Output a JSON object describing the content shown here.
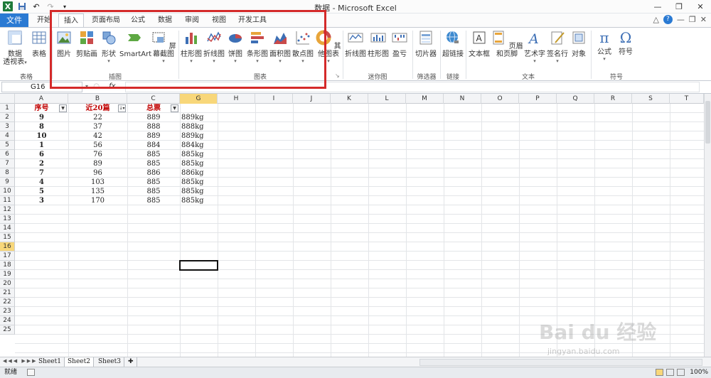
{
  "window": {
    "title": "数据 - Microsoft Excel",
    "controls": [
      "minimize-icon",
      "restore-icon",
      "close-icon"
    ]
  },
  "tabs": {
    "file": "文件",
    "items": [
      {
        "label": "开始"
      },
      {
        "label": "插入",
        "active": true
      },
      {
        "label": "页面布局"
      },
      {
        "label": "公式"
      },
      {
        "label": "数据"
      },
      {
        "label": "审阅"
      },
      {
        "label": "视图"
      },
      {
        "label": "开发工具"
      }
    ]
  },
  "ribbon": {
    "groups": {
      "table": "表格",
      "illustration": "插图",
      "chart": "图表",
      "sparkline": "迷你图",
      "filter": "筛选器",
      "link": "链接",
      "text": "文本",
      "symbol": "符号"
    },
    "buttons": {
      "pivot_line1": "数据",
      "pivot_line2": "透视表",
      "table": "表格",
      "picture": "图片",
      "clipart": "剪贴画",
      "shapes": "形状",
      "smartart": "SmartArt",
      "screenshot": "屏幕截图",
      "column_chart": "柱形图",
      "line_chart": "折线图",
      "pie_chart": "饼图",
      "bar_chart": "条形图",
      "area_chart": "面积图",
      "scatter_chart": "散点图",
      "other_chart": "其他图表",
      "spark_line": "折线图",
      "spark_column": "柱形图",
      "spark_winloss": "盈亏",
      "slicer": "切片器",
      "hyperlink": "超链接",
      "textbox": "文本框",
      "header_footer": "页眉和页脚",
      "wordart": "艺术字",
      "signature": "签名行",
      "object": "对象",
      "equation": "公式",
      "symbol": "符号"
    }
  },
  "formula_bar": {
    "name_box": "G16",
    "fx": "fx",
    "value": ""
  },
  "sheet": {
    "columns": [
      "A",
      "B",
      "C",
      "G",
      "H",
      "I",
      "J",
      "K",
      "L",
      "M",
      "N",
      "O",
      "P",
      "Q",
      "R",
      "S",
      "T"
    ],
    "rows": [
      "1",
      "2",
      "3",
      "4",
      "5",
      "6",
      "7",
      "8",
      "9",
      "10",
      "11",
      "12",
      "13",
      "14",
      "15",
      "16",
      "17",
      "18",
      "19",
      "20",
      "21",
      "22",
      "23",
      "24",
      "25"
    ],
    "headers": {
      "a": "序号",
      "b": "近20篇",
      "c": "总票"
    },
    "data": [
      {
        "a": "9",
        "b": "22",
        "c": "889",
        "g": "889kg"
      },
      {
        "a": "8",
        "b": "37",
        "c": "888",
        "g": "888kg"
      },
      {
        "a": "10",
        "b": "42",
        "c": "889",
        "g": "889kg"
      },
      {
        "a": "1",
        "b": "56",
        "c": "884",
        "g": "884kg"
      },
      {
        "a": "6",
        "b": "76",
        "c": "885",
        "g": "885kg"
      },
      {
        "a": "2",
        "b": "89",
        "c": "885",
        "g": "885kg"
      },
      {
        "a": "7",
        "b": "96",
        "c": "886",
        "g": "886kg"
      },
      {
        "a": "4",
        "b": "103",
        "c": "885",
        "g": "885kg"
      },
      {
        "a": "5",
        "b": "135",
        "c": "885",
        "g": "885kg"
      },
      {
        "a": "3",
        "b": "170",
        "c": "885",
        "g": "885kg"
      }
    ],
    "selected_cell": "G16"
  },
  "sheet_tabs": [
    {
      "label": "Sheet1"
    },
    {
      "label": "Sheet2",
      "active": true
    },
    {
      "label": "Sheet3"
    }
  ],
  "status": {
    "ready": "就绪",
    "zoom": "100%"
  },
  "watermark": {
    "brand": "Bai du 经验",
    "url": "jingyan.baidu.com"
  },
  "colors": {
    "file_tab": "#2a7ad3",
    "header_text": "#c00000",
    "highlight": "#d42a2a",
    "selected_header": "#f8d77a"
  }
}
